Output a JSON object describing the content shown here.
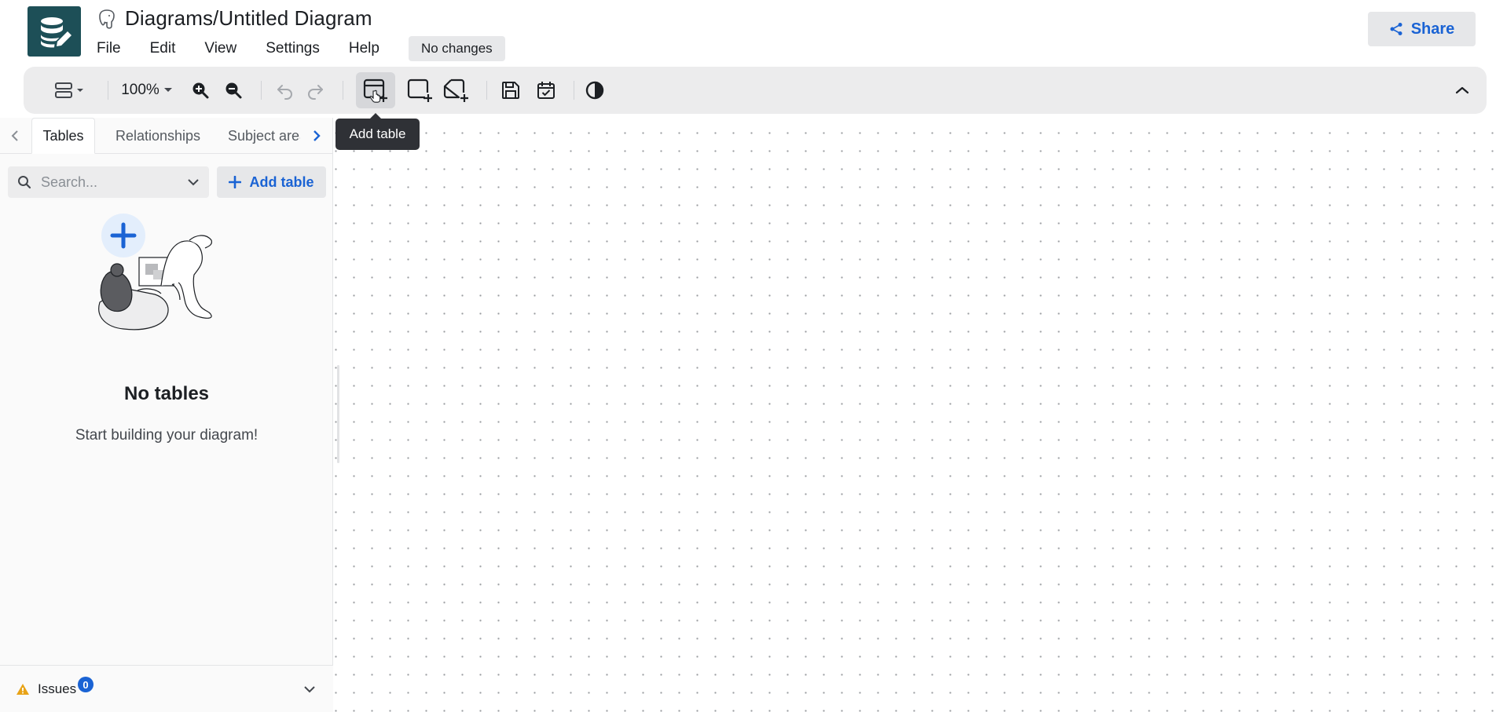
{
  "header": {
    "title": "Diagrams/Untitled Diagram",
    "status": "No changes",
    "share_label": "Share",
    "menu": [
      "File",
      "Edit",
      "View",
      "Settings",
      "Help"
    ]
  },
  "toolbar": {
    "zoom": "100%",
    "tooltip": "Add table",
    "icons": [
      "layout-icon",
      "zoom-in-icon",
      "zoom-out-icon",
      "undo-icon",
      "redo-icon",
      "add-table-icon",
      "add-area-icon",
      "add-note-icon",
      "save-icon",
      "calendar-check-icon",
      "theme-toggle-icon",
      "collapse-icon"
    ]
  },
  "sidebar": {
    "tabs": [
      "Tables",
      "Relationships",
      "Subject areas"
    ],
    "search_placeholder": "Search...",
    "add_table_label": "Add table",
    "empty_title": "No tables",
    "empty_subtitle": "Start building your diagram!",
    "issues_label": "Issues",
    "issues_count": "0"
  },
  "colors": {
    "accent": "#1a63d4",
    "logo_bg": "#1d4f57",
    "toolbar_bg": "#ececed",
    "warning": "#e8a317"
  }
}
